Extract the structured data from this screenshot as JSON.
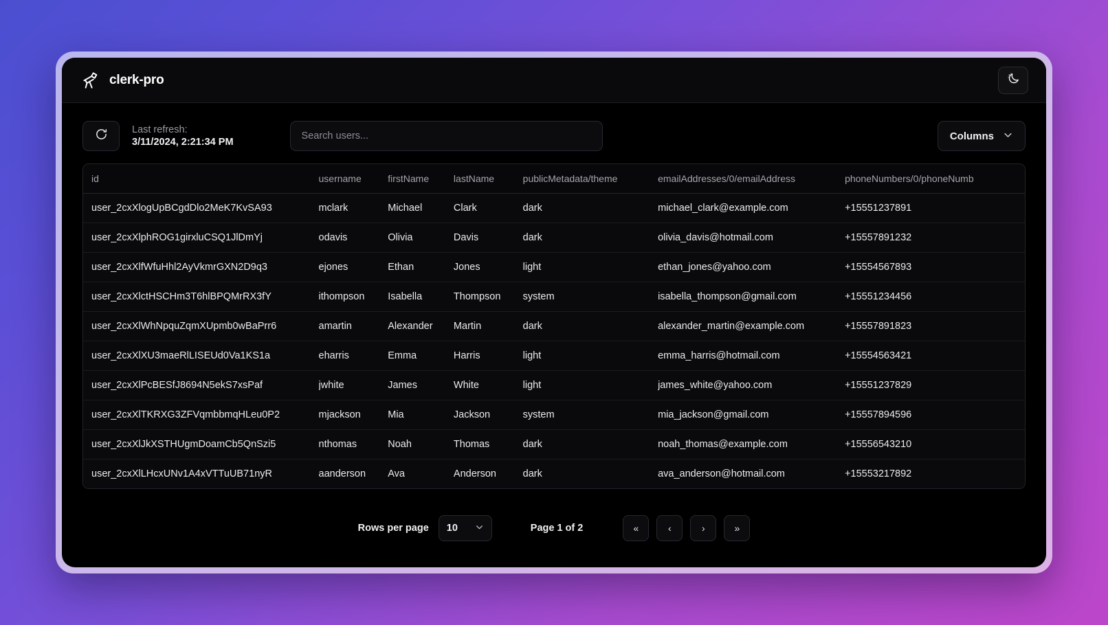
{
  "titlebar": {
    "app_title": "clerk-pro",
    "logo_icon": "telescope-icon",
    "theme_toggle_icon": "moon-stars-icon"
  },
  "toolbar": {
    "refresh_icon": "refresh-cw-icon",
    "refresh_label": "Last refresh:",
    "refresh_time": "3/11/2024, 2:21:34 PM",
    "search_placeholder": "Search users...",
    "search_value": "",
    "columns_label": "Columns",
    "columns_chevron_icon": "chevron-down-icon"
  },
  "table": {
    "columns": [
      "id",
      "username",
      "firstName",
      "lastName",
      "publicMetadata/theme",
      "emailAddresses/0/emailAddress",
      "phoneNumbers/0/phoneNumb"
    ],
    "rows": [
      {
        "id": "user_2cxXlogUpBCgdDlo2MeK7KvSA93",
        "username": "mclark",
        "firstName": "Michael",
        "lastName": "Clark",
        "theme": "dark",
        "email": "michael_clark@example.com",
        "phone": "+15551237891"
      },
      {
        "id": "user_2cxXlphROG1girxluCSQ1JlDmYj",
        "username": "odavis",
        "firstName": "Olivia",
        "lastName": "Davis",
        "theme": "dark",
        "email": "olivia_davis@hotmail.com",
        "phone": "+15557891232"
      },
      {
        "id": "user_2cxXlfWfuHhl2AyVkmrGXN2D9q3",
        "username": "ejones",
        "firstName": "Ethan",
        "lastName": "Jones",
        "theme": "light",
        "email": "ethan_jones@yahoo.com",
        "phone": "+15554567893"
      },
      {
        "id": "user_2cxXlctHSCHm3T6hlBPQMrRX3fY",
        "username": "ithompson",
        "firstName": "Isabella",
        "lastName": "Thompson",
        "theme": "system",
        "email": "isabella_thompson@gmail.com",
        "phone": "+15551234456"
      },
      {
        "id": "user_2cxXlWhNpquZqmXUpmb0wBaPrr6",
        "username": "amartin",
        "firstName": "Alexander",
        "lastName": "Martin",
        "theme": "dark",
        "email": "alexander_martin@example.com",
        "phone": "+15557891823"
      },
      {
        "id": "user_2cxXlXU3maeRlLISEUd0Va1KS1a",
        "username": "eharris",
        "firstName": "Emma",
        "lastName": "Harris",
        "theme": "light",
        "email": "emma_harris@hotmail.com",
        "phone": "+15554563421"
      },
      {
        "id": "user_2cxXlPcBESfJ8694N5ekS7xsPaf",
        "username": "jwhite",
        "firstName": "James",
        "lastName": "White",
        "theme": "light",
        "email": "james_white@yahoo.com",
        "phone": "+15551237829"
      },
      {
        "id": "user_2cxXlTKRXG3ZFVqmbbmqHLeu0P2",
        "username": "mjackson",
        "firstName": "Mia",
        "lastName": "Jackson",
        "theme": "system",
        "email": "mia_jackson@gmail.com",
        "phone": "+15557894596"
      },
      {
        "id": "user_2cxXlJkXSTHUgmDoamCb5QnSzi5",
        "username": "nthomas",
        "firstName": "Noah",
        "lastName": "Thomas",
        "theme": "dark",
        "email": "noah_thomas@example.com",
        "phone": "+15556543210"
      },
      {
        "id": "user_2cxXlLHcxUNv1A4xVTTuUB71nyR",
        "username": "aanderson",
        "firstName": "Ava",
        "lastName": "Anderson",
        "theme": "dark",
        "email": "ava_anderson@hotmail.com",
        "phone": "+15553217892"
      }
    ]
  },
  "pagination": {
    "rows_per_page_label": "Rows per page",
    "rows_per_page_value": "10",
    "rows_per_page_chevron_icon": "chevron-down-icon",
    "page_status": "Page 1 of 2",
    "first_page_label": "«",
    "prev_page_label": "‹",
    "next_page_label": "›",
    "last_page_label": "»"
  },
  "colors": {
    "window_bg": "#000000",
    "panel_bg": "#0a0a0c",
    "border": "#272730",
    "frame": "#c5b9ea",
    "text_primary": "#ececf0",
    "text_muted": "#9b9ba4"
  }
}
